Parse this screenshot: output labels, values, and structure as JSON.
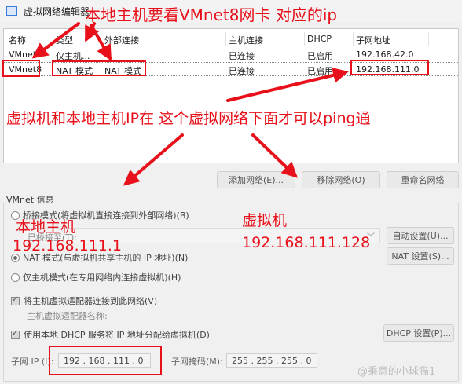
{
  "window": {
    "title": "虚拟网络编辑器"
  },
  "table": {
    "headers": [
      "名称",
      "类型",
      "外部连接",
      "主机连接",
      "DHCP",
      "子网地址"
    ],
    "rows": [
      [
        "VMnet1",
        "仅主机...",
        "-",
        "已连接",
        "已启用",
        "192.168.42.0"
      ],
      [
        "VMnet8",
        "NAT 模式",
        "NAT 模式",
        "已连接",
        "已启用",
        "192.168.111.0"
      ]
    ]
  },
  "buttons": {
    "add_network": "添加网络(E)...",
    "remove_network": "移除网络(O)",
    "rename_network": "重命名网络",
    "auto_settings": "自动设置(U)...",
    "nat_settings": "NAT 设置(S)...",
    "dhcp_settings": "DHCP 设置(P)..."
  },
  "vmnet_info": {
    "section_title": "VMnet 信息",
    "bridge_mode": "桥接模式(将虚拟机直接连接到外部网络)(B)",
    "bridge_to_value": "已桥接至(T):",
    "nat_mode": "NAT 模式(与虚拟机共享主机的 IP 地址)(N)",
    "host_only_mode": "仅主机模式(在专用网络内连接虚拟机)(H)",
    "connect_adapter": "将主机虚拟适配器连接到此网络(V)",
    "adapter_name_label": "主机虚拟适配器名称:",
    "use_dhcp": "使用本地 DHCP 服务将 IP 地址分配给虚拟机(D)",
    "subnet_ip_label": "子网 IP (I):",
    "subnet_ip_value": "192 . 168 . 111 . 0",
    "subnet_mask_label": "子网掩码(M):",
    "subnet_mask_value": "255 . 255 . 255 . 0"
  },
  "annotations": {
    "top": "本地主机要看VMnet8网卡 对应的ip",
    "middle": "虚拟机和本地主机IP在 这个虚拟网络下面才可以ping通",
    "host_label": "本地主机",
    "host_ip": "192.168.111.1",
    "vm_label": "虚拟机",
    "vm_ip": "192.168.111.128"
  },
  "watermark": "@乘意的小球猫1",
  "colors": {
    "annotation": "#e8101a",
    "window_bg": "#f0f0f0"
  },
  "icons": {
    "app": "network-editor-icon",
    "dropdown": "chevron-down-icon"
  }
}
